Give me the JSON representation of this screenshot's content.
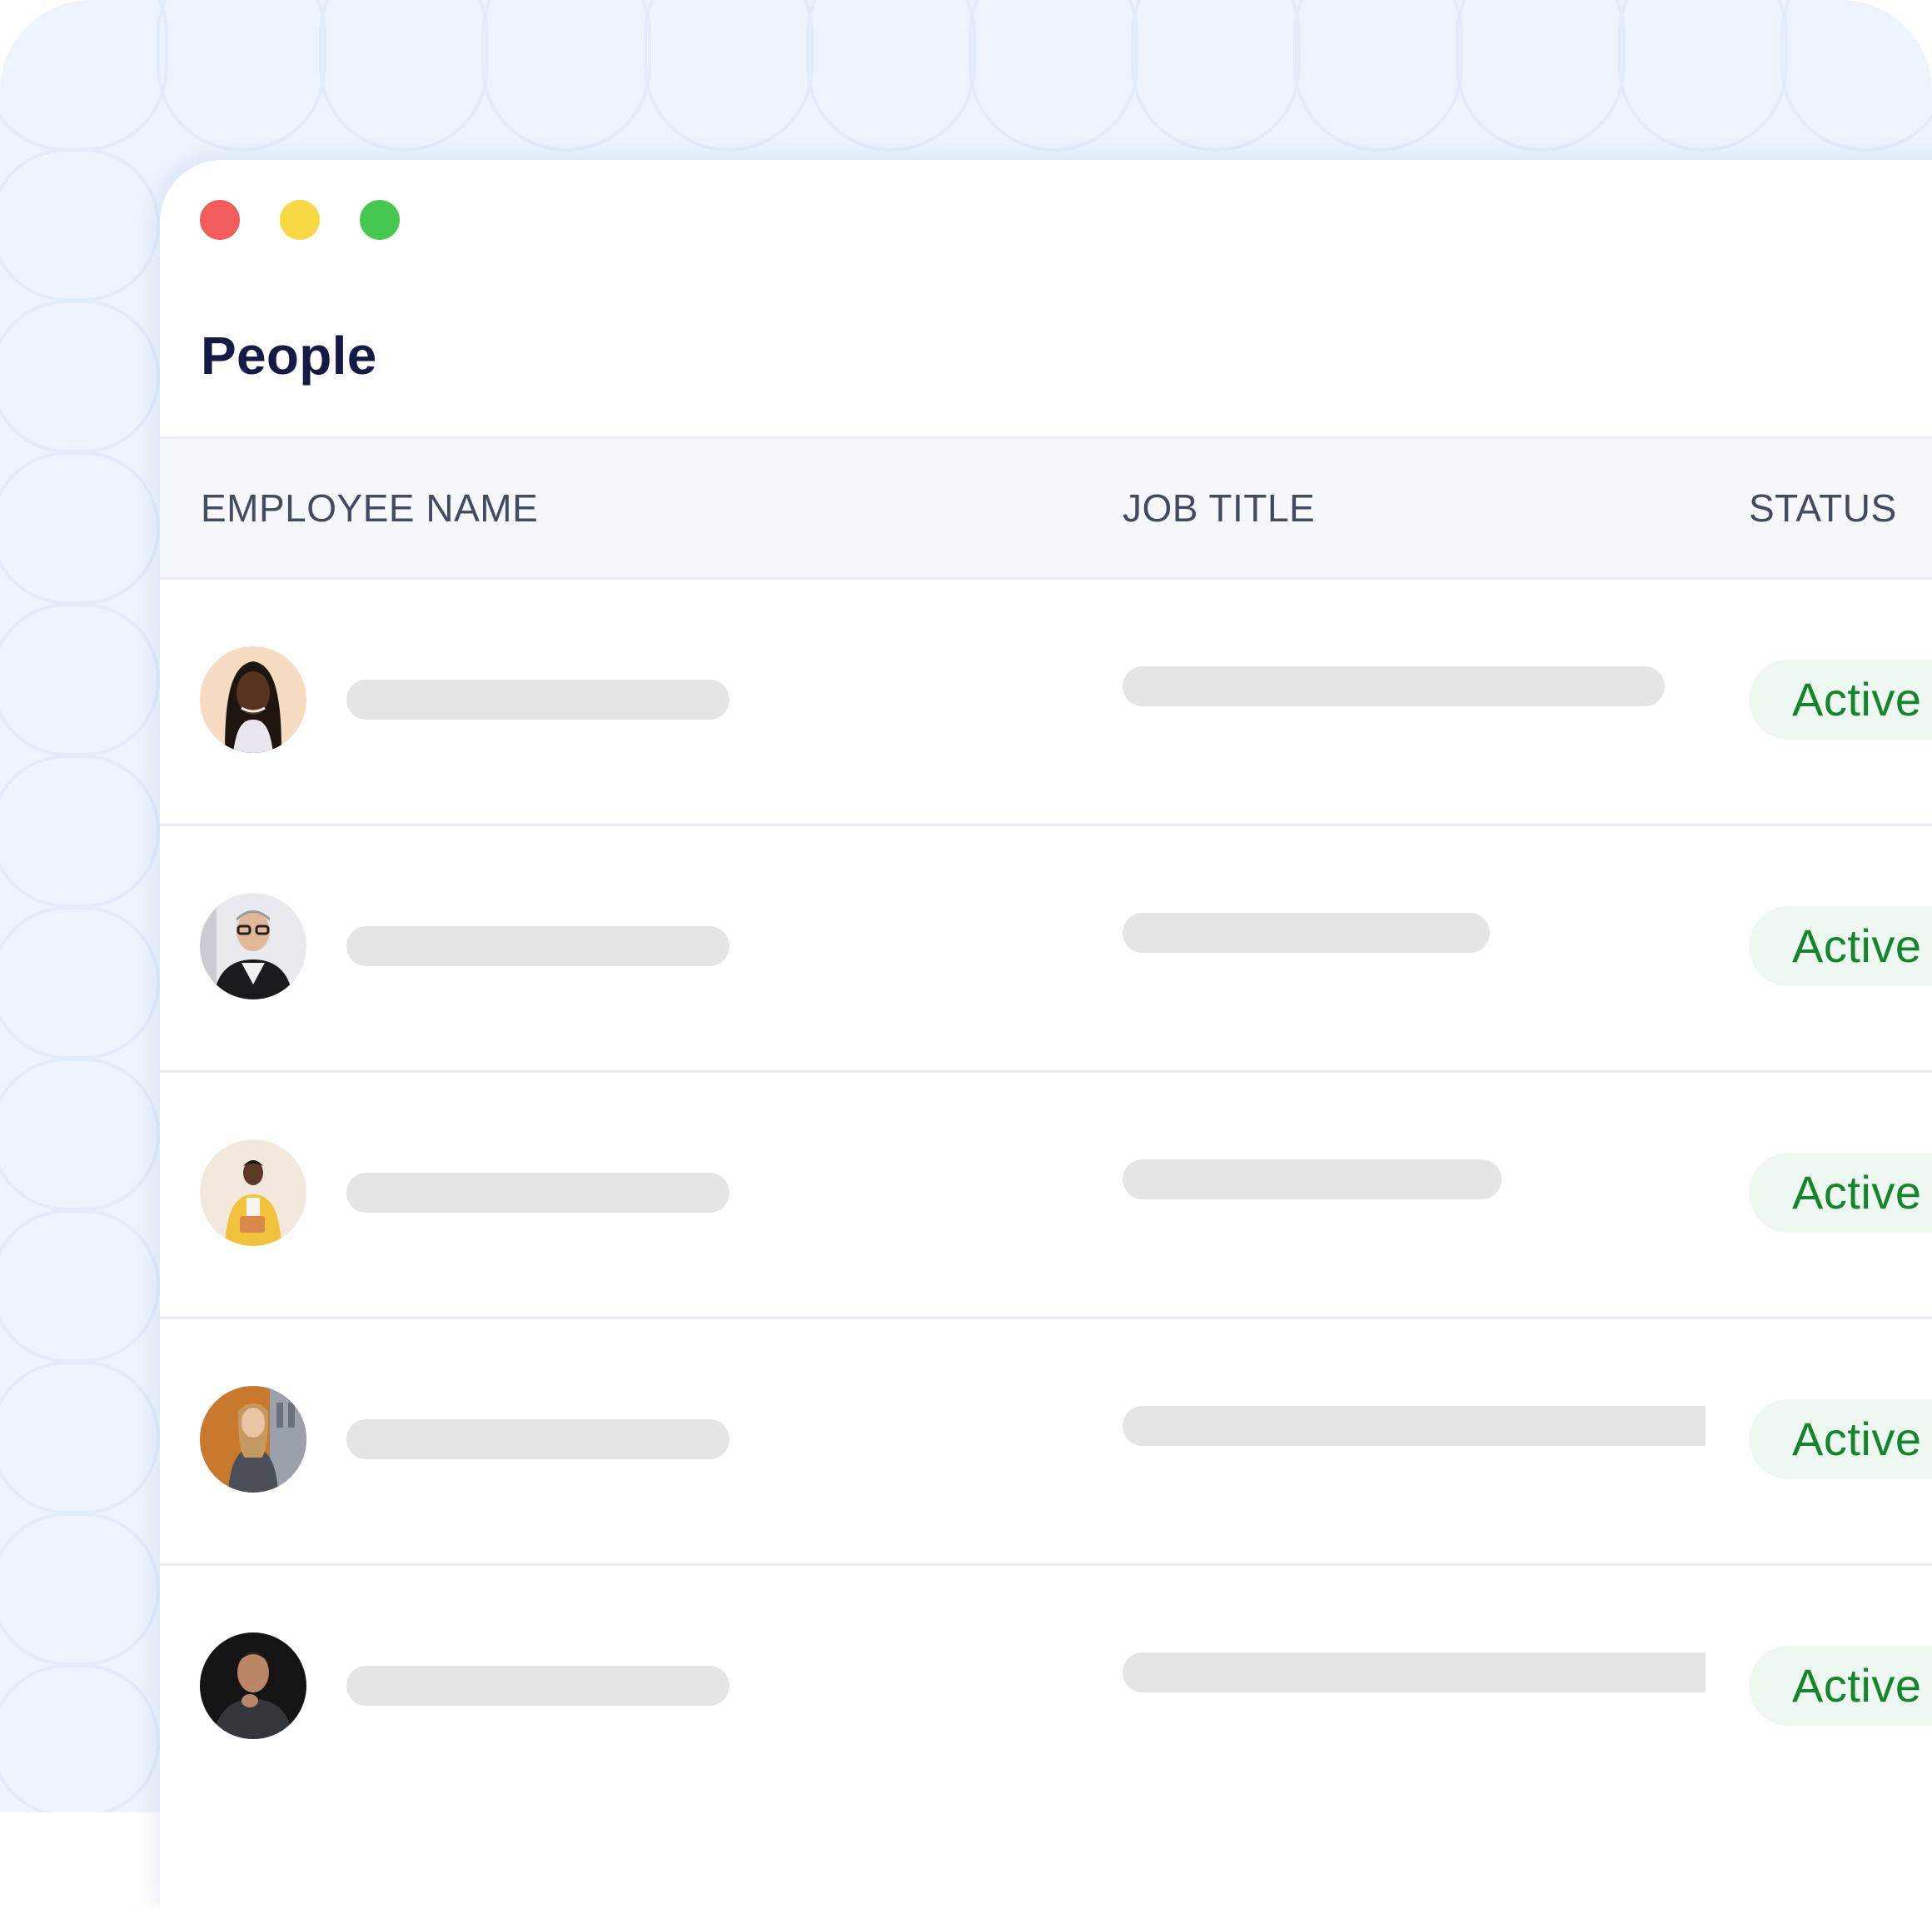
{
  "window": {
    "controls": [
      {
        "name": "close-dot",
        "color": "#f25c5c"
      },
      {
        "name": "minimize-dot",
        "color": "#f7d944"
      },
      {
        "name": "maximize-dot",
        "color": "#45c84d"
      }
    ]
  },
  "page": {
    "title": "People"
  },
  "table": {
    "columns": [
      "EMPLOYEE NAME",
      "JOB TITLE",
      "STATUS"
    ],
    "rows": [
      {
        "avatar": "portrait-woman-braids-icon",
        "status": "Active",
        "job_fill": 0.93
      },
      {
        "avatar": "portrait-man-glasses-icon",
        "status": "Active",
        "job_fill": 0.63
      },
      {
        "avatar": "portrait-woman-yellow-jacket-icon",
        "status": "Active",
        "job_fill": 0.65
      },
      {
        "avatar": "portrait-woman-blazer-icon",
        "status": "Active",
        "job_fill": 1.0
      },
      {
        "avatar": "portrait-man-dark-shirt-icon",
        "status": "Active",
        "job_fill": 1.0
      }
    ]
  },
  "colors": {
    "title": "#131a45",
    "header_text": "#434b63",
    "status_text": "#13852d",
    "status_bg": "#eef8f1",
    "placeholder": "#e5e5e5",
    "backdrop": "#eef4fd"
  }
}
